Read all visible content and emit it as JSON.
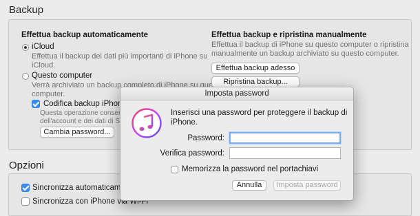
{
  "backup": {
    "title": "Backup",
    "auto": {
      "heading": "Effettua backup automaticamente",
      "icloud_label": "iCloud",
      "icloud_desc_1": "Effettua il backup dei dati più importanti di iPhone su",
      "icloud_desc_2": "iCloud.",
      "computer_label": "Questo computer",
      "computer_desc_1": "Verrà archiviato un backup completo di iPhone su questo",
      "computer_desc_2": "computer.",
      "encrypt_label": "Codifica backup iPhone",
      "encrypt_desc_1": "Questa operazione consente il b",
      "encrypt_desc_2": "dell'account e dei dati di Salute",
      "change_password_btn": "Cambia password..."
    },
    "manual": {
      "heading": "Effettua backup e ripristina manualmente",
      "desc_1": "Effettua il backup di iPhone su questo computer o ripristina",
      "desc_2": "manualmente un backup archiviato su questo computer.",
      "backup_now_btn": "Effettua backup adesso",
      "restore_btn": "Ripristina backup..."
    }
  },
  "options": {
    "title": "Opzioni",
    "sync_auto_label": "Sincronizza automaticamente c",
    "sync_wifi_label": "Sincronizza con iPhone via Wi-Fi"
  },
  "dialog": {
    "title": "Imposta password",
    "message_1": "Inserisci una password per proteggere il backup di",
    "message_2": "iPhone.",
    "password_label": "Password:",
    "verify_label": "Verifica password:",
    "password_value": "",
    "verify_value": "",
    "remember_label": "Memorizza la password nel portachiavi",
    "cancel_btn": "Annulla",
    "set_btn": "Imposta password",
    "icon": "itunes-music-icon"
  }
}
